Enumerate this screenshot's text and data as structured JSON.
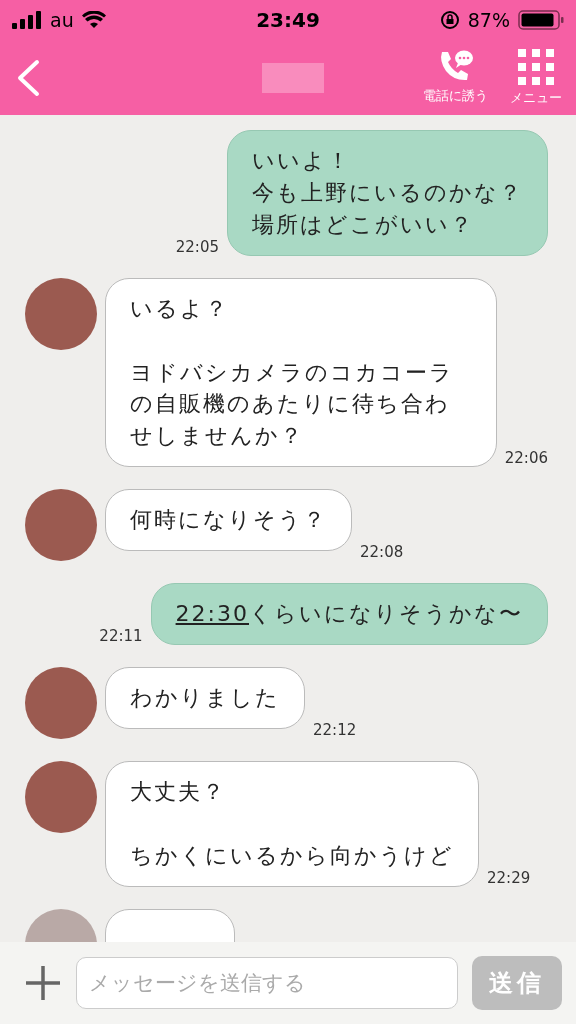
{
  "status_bar": {
    "carrier": "au",
    "time": "23:49",
    "battery": "87%"
  },
  "header": {
    "call_label": "電話に誘う",
    "menu_label": "メニュー"
  },
  "messages": [
    {
      "kind": "sent",
      "paragraphs": [
        [
          "いいよ！",
          "今も上野にいるのかな？",
          "場所はどこがいい？"
        ]
      ],
      "time": "22:05"
    },
    {
      "kind": "received",
      "paragraphs": [
        [
          "いるよ？"
        ],
        [
          "ヨドバシカメラのコカコーラの自販機のあたりに待ち合わせしませんか？"
        ]
      ],
      "time": "22:06"
    },
    {
      "kind": "received",
      "paragraphs": [
        [
          "何時になりそう？"
        ]
      ],
      "time": "22:08"
    },
    {
      "kind": "sent",
      "link_text": "22:30",
      "paragraphs": [
        [
          "くらいになりそうかな〜"
        ]
      ],
      "time": "22:11"
    },
    {
      "kind": "received",
      "paragraphs": [
        [
          "わかりました"
        ]
      ],
      "time": "22:12"
    },
    {
      "kind": "received",
      "paragraphs": [
        [
          "大丈夫？"
        ],
        [
          "ちかくにいるから向かうけど"
        ]
      ],
      "time": "22:29"
    },
    {
      "kind": "received_partial"
    }
  ],
  "composer": {
    "placeholder": "メッセージを送信する",
    "send_label": "送信"
  }
}
